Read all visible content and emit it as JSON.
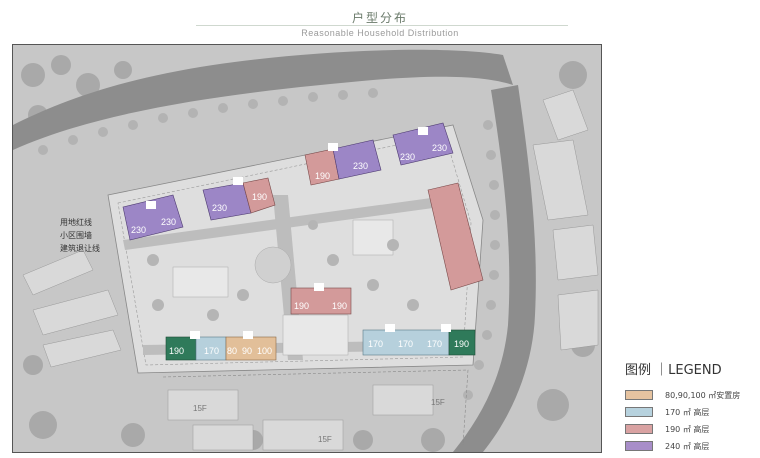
{
  "header": {
    "title_cn": "户型分布",
    "title_en": "Reasonable Household Distribution"
  },
  "side_labels": [
    "用地红线",
    "小区围墙",
    "建筑退让线"
  ],
  "map_labels": {
    "floors": [
      "15F",
      "15F",
      "15F"
    ]
  },
  "units": {
    "b1": [
      "230",
      "230"
    ],
    "b2": [
      "230",
      "190"
    ],
    "b3": [
      "190",
      "230"
    ],
    "b4": [
      "230",
      "230"
    ],
    "b5": [
      "190",
      "190"
    ],
    "b6": [
      "190",
      "170"
    ],
    "b7": [
      "80",
      "90",
      "100"
    ],
    "b8": [
      "170",
      "170",
      "170",
      "190"
    ]
  },
  "legend": {
    "title": "图例 ｜LEGEND",
    "items": [
      {
        "label": "80,90,100 ㎡安置房",
        "color": "#e6c3a0"
      },
      {
        "label": "170 ㎡ 高层",
        "color": "#b7d2de"
      },
      {
        "label": "190 ㎡ 高层",
        "color": "#d9a2a2"
      },
      {
        "label": "240 ㎡ 高层",
        "color": "#a88ec9"
      }
    ]
  },
  "colors": {
    "purple": "#9c86c6",
    "pink": "#d39a9a",
    "blue": "#b6d0dc",
    "tan": "#e2bf99",
    "green": "#2f7a5a"
  }
}
